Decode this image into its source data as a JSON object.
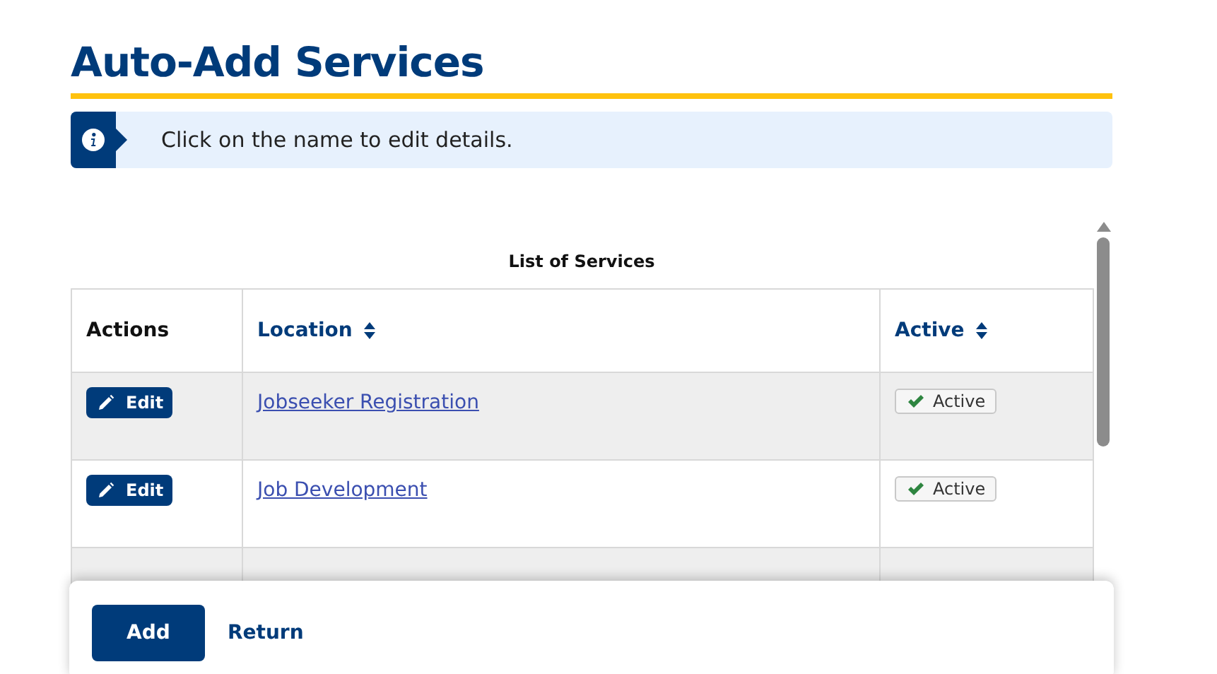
{
  "title": "Auto-Add Services",
  "info": {
    "text": "Click on the name to edit details."
  },
  "table": {
    "caption": "List of Services",
    "columns": [
      {
        "label": "Actions",
        "sortable": false
      },
      {
        "label": "Location",
        "sortable": true
      },
      {
        "label": "Active",
        "sortable": true
      }
    ],
    "rows": [
      {
        "action": "Edit",
        "location": "Jobseeker Registration",
        "status": "Active"
      },
      {
        "action": "Edit",
        "location": "Job Development",
        "status": "Active"
      }
    ]
  },
  "footer": {
    "buttons": [
      {
        "label": "Add",
        "kind": "primary"
      },
      {
        "label": "Return",
        "kind": "link"
      }
    ]
  }
}
